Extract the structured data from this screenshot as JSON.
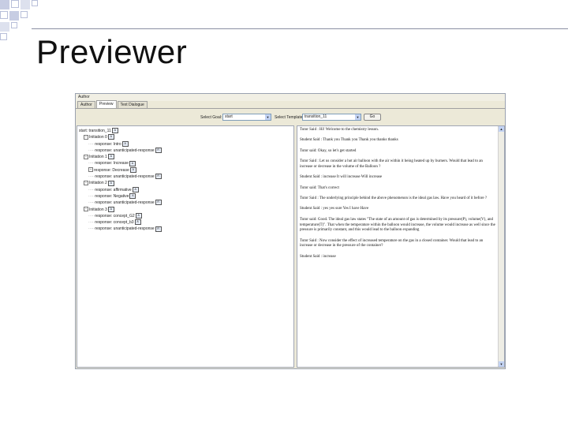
{
  "slide": {
    "title": "Previewer"
  },
  "app": {
    "menu": "Author",
    "tabs": [
      "Author",
      "Preview",
      "Text Dialogue"
    ],
    "active_tab": 1,
    "toolbar": {
      "goal_label": "Select Goal:",
      "goal_value": "start",
      "template_label": "Select Template:",
      "template_value": "transition_11",
      "go_label": "Go"
    },
    "tree": [
      {
        "indent": 0,
        "text": "start: transition_11",
        "toggle": "",
        "icon": "A"
      },
      {
        "indent": 1,
        "text": "Initiation 0",
        "toggle": "−",
        "icon": "A"
      },
      {
        "indent": 2,
        "text": "response: Intro",
        "toggle": "",
        "icon": "A"
      },
      {
        "indent": 2,
        "text": "response: unanticipated-response",
        "toggle": "",
        "icon": "R"
      },
      {
        "indent": 1,
        "text": "Initiation 1",
        "toggle": "−",
        "icon": "A"
      },
      {
        "indent": 2,
        "text": "response: Increase",
        "toggle": "",
        "icon": "A"
      },
      {
        "indent": 2,
        "text": "response: Decrease",
        "toggle": "+",
        "icon": "A"
      },
      {
        "indent": 2,
        "text": "response: unanticipated-response",
        "toggle": "",
        "icon": "R"
      },
      {
        "indent": 1,
        "text": "Initiation 2",
        "toggle": "−",
        "icon": "A"
      },
      {
        "indent": 2,
        "text": "response: affirmative",
        "toggle": "",
        "icon": "A"
      },
      {
        "indent": 2,
        "text": "response: Negative",
        "toggle": "",
        "icon": "A"
      },
      {
        "indent": 2,
        "text": "response: unanticipated-response",
        "toggle": "",
        "icon": "R"
      },
      {
        "indent": 1,
        "text": "Initiation 3",
        "toggle": "−",
        "icon": "A"
      },
      {
        "indent": 2,
        "text": "response: concept_G2",
        "toggle": "",
        "icon": "A"
      },
      {
        "indent": 2,
        "text": "response: concept_b3",
        "toggle": "",
        "icon": "A"
      },
      {
        "indent": 2,
        "text": "response: unanticipated-response",
        "toggle": "",
        "icon": "R"
      }
    ],
    "transcript": [
      "Tutor Said : Hi! Welcome to the chemistry lesson.",
      "Student Said : Thank you   Thank you   Thank you   thanks   thanks",
      "Tutor said: Okay, so let's get started",
      "Tutor Said : Let us consider a hot air balloon with the air within it being heated up by burners. Would that lead to an increase or decrease in the volume of the Balloon ?",
      "Student Said : increase   It will increase   Will increase",
      "Tutor said: That's correct",
      "Tutor Said : The underlying principle behind the above phenomenon is the ideal gas law. Have you heard of it before ?",
      "Student Said : yes   yes   sure   Yes I have   Have",
      "Tutor said: Good. The ideal gas law states \"The state of an amount of gas is determined by its pressure(P), volume(V), and temperature(T)\". That when the temperature within the balloon would increase, the volume would increase as well since the pressure is primarily constant, and this would lead to the balloon expanding",
      "Tutor Said : Now consider the effect of increased temperature on the gas in a closed container. Would that lead to an increase or decrease in the pressure of the container?",
      "Student Said : increase"
    ]
  }
}
